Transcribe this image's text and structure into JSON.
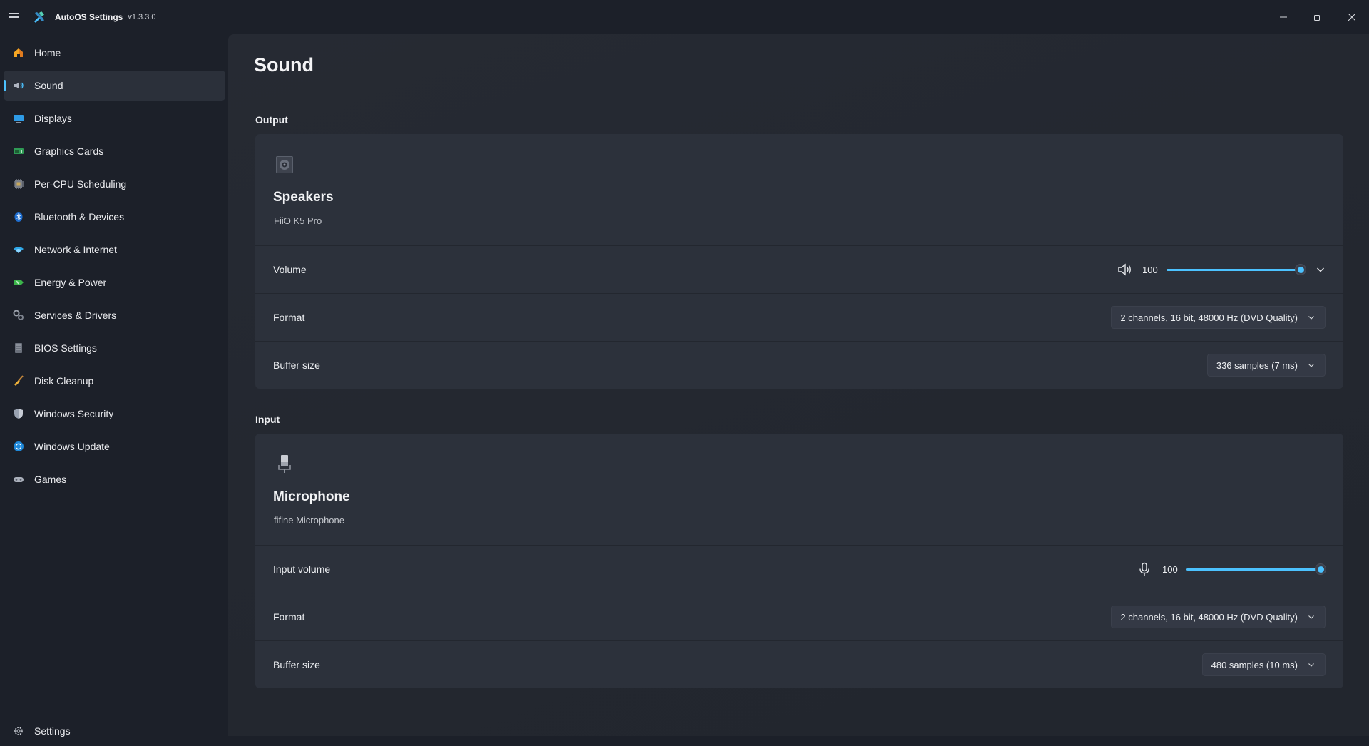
{
  "app": {
    "title": "AutoOS Settings",
    "version": "v1.3.3.0"
  },
  "sidebar": {
    "items": [
      {
        "label": "Home",
        "icon": "home-icon"
      },
      {
        "label": "Sound",
        "icon": "speaker-icon",
        "active": true
      },
      {
        "label": "Displays",
        "icon": "display-icon"
      },
      {
        "label": "Graphics Cards",
        "icon": "gpu-icon"
      },
      {
        "label": "Per-CPU Scheduling",
        "icon": "cpu-icon"
      },
      {
        "label": "Bluetooth & Devices",
        "icon": "bluetooth-icon"
      },
      {
        "label": "Network & Internet",
        "icon": "wifi-icon"
      },
      {
        "label": "Energy & Power",
        "icon": "battery-icon"
      },
      {
        "label": "Services & Drivers",
        "icon": "gears-icon"
      },
      {
        "label": "BIOS Settings",
        "icon": "chip-icon"
      },
      {
        "label": "Disk Cleanup",
        "icon": "broom-icon"
      },
      {
        "label": "Windows Security",
        "icon": "shield-icon"
      },
      {
        "label": "Windows Update",
        "icon": "update-icon"
      },
      {
        "label": "Games",
        "icon": "gamepad-icon"
      }
    ],
    "footer": {
      "label": "Settings",
      "icon": "gear-icon"
    }
  },
  "page": {
    "title": "Sound"
  },
  "output": {
    "section_title": "Output",
    "device_name": "Speakers",
    "device_model": "FiiO K5 Pro",
    "volume_label": "Volume",
    "volume_value": "100",
    "volume_level": 100,
    "format_label": "Format",
    "format_value": "2 channels, 16 bit, 48000 Hz (DVD Quality)",
    "buffer_label": "Buffer size",
    "buffer_value": "336 samples (7 ms)"
  },
  "input": {
    "section_title": "Input",
    "device_name": "Microphone",
    "device_model": "fifine Microphone",
    "volume_label": "Input volume",
    "volume_value": "100",
    "volume_level": 100,
    "format_label": "Format",
    "format_value": "2 channels, 16 bit, 48000 Hz (DVD Quality)",
    "buffer_label": "Buffer size",
    "buffer_value": "480 samples (10 ms)"
  },
  "colors": {
    "accent": "#4cc2ff",
    "background": "#1c2029",
    "content": "#262a33",
    "card": "#2c313b"
  }
}
